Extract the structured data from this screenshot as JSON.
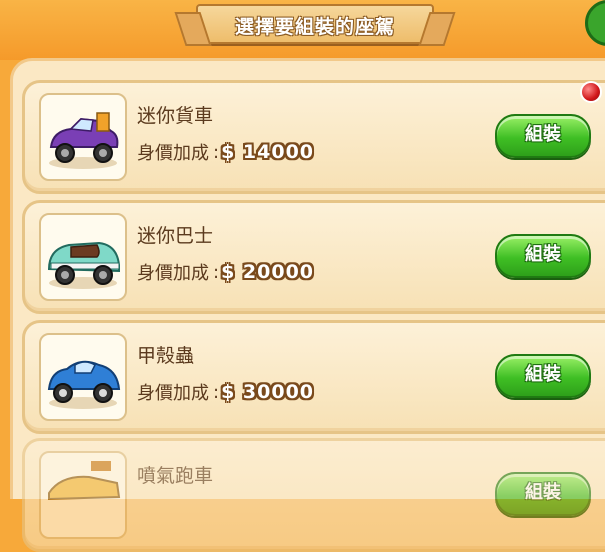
{
  "header": {
    "title": "選擇要組裝的座駕"
  },
  "colors": {
    "panel": "#fbe8c4",
    "button_green": "#3fbf24",
    "badge_red": "#d0161a"
  },
  "price_label": "身價加成",
  "price_colon": ":",
  "assemble_label": "組裝",
  "cars": [
    {
      "name": "迷你貨車",
      "price": "$ 14000",
      "icon": "purple-convertible-car-icon",
      "has_badge": true
    },
    {
      "name": "迷你巴士",
      "price": "$ 20000",
      "icon": "teal-minibus-car-icon",
      "has_badge": false
    },
    {
      "name": "甲殼蟲",
      "price": "$ 30000",
      "icon": "blue-beetle-car-icon",
      "has_badge": false
    },
    {
      "name": "噴氣跑車",
      "icon": "jet-sports-car-icon",
      "has_badge": false
    }
  ]
}
